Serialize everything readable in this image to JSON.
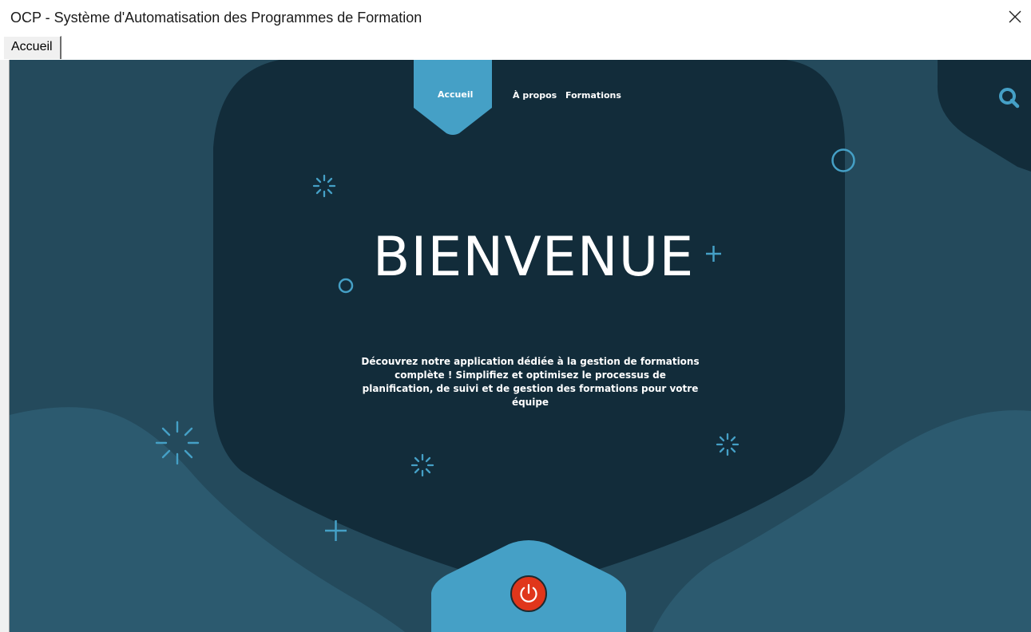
{
  "window": {
    "title": "OCP - Système d'Automatisation des Programmes de Formation"
  },
  "tabs": [
    {
      "label": "Accueil",
      "active": true
    }
  ],
  "nav": {
    "active": "Accueil",
    "links": [
      "À propos",
      "Formations"
    ]
  },
  "hero": {
    "title": "BIENVENUE",
    "description": "Découvrez notre application dédiée à la gestion de formations complète ! Simplifiez et optimisez le processus de planification, de suivi et de gestion des formations pour votre équipe"
  },
  "icons": {
    "close": "close-icon",
    "search": "search-icon",
    "power": "power-icon"
  },
  "colors": {
    "background": "#244a5c",
    "panel": "#122c3a",
    "accent": "#45a0c6",
    "wave": "#2c5a6f",
    "power": "#e0361b"
  }
}
